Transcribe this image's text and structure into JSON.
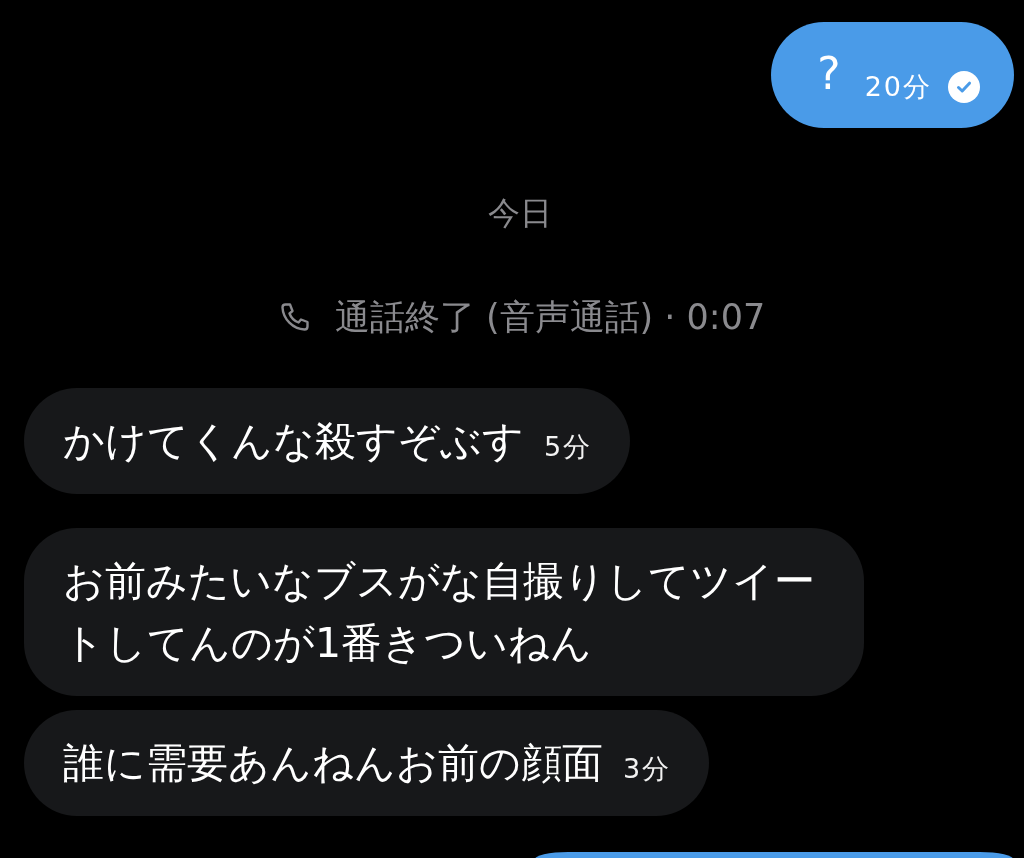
{
  "conversation": {
    "items": [
      {
        "kind": "sent",
        "text": "?",
        "time": "20分",
        "read": true
      },
      {
        "kind": "date",
        "text": "今日"
      },
      {
        "kind": "call",
        "text": "通話終了 (音声通話) · 0:07"
      },
      {
        "kind": "received",
        "text": "かけてくんな殺すぞぶす",
        "time": "5分"
      },
      {
        "kind": "received",
        "text": "お前みたいなブスがな自撮りしてツイートしてんのが1番きついねん"
      },
      {
        "kind": "received",
        "text": "誰に需要あんねんお前の顔面",
        "time": "3分"
      },
      {
        "kind": "sent"
      }
    ]
  }
}
